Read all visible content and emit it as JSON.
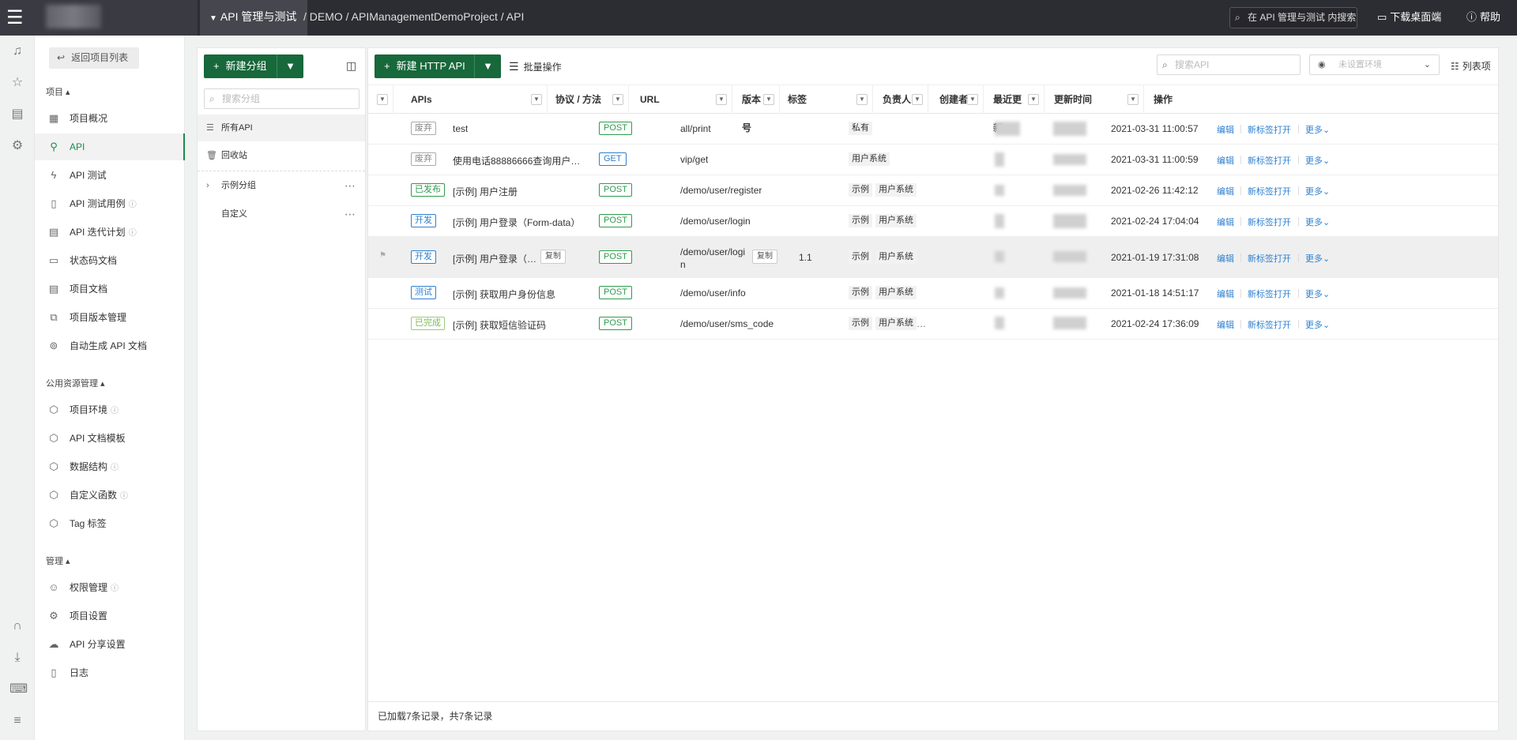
{
  "topbar": {
    "project_menu": "API 管理与测试",
    "breadcrumb": "/ DEMO / APIManagementDemoProject / API",
    "search_label": "在 API 管理与测试 内搜索",
    "download": "下载桌面端",
    "help": "帮助"
  },
  "sidebar": {
    "back": "返回项目列表",
    "section_project": "项目",
    "items_project": [
      "项目概况",
      "API",
      "API 测试",
      "API 测试用例",
      "API 迭代计划",
      "状态码文档",
      "项目文档",
      "项目版本管理",
      "自动生成 API 文档"
    ],
    "section_public": "公用资源管理",
    "items_public": [
      "项目环境",
      "API 文档模板",
      "数据结构",
      "自定义函数",
      "Tag 标签"
    ],
    "section_manage": "管理",
    "items_manage": [
      "权限管理",
      "项目设置",
      "API 分享设置",
      "日志"
    ]
  },
  "groups": {
    "new_group": "新建分组",
    "search_placeholder": "搜索分组",
    "all": "所有API",
    "recycle": "回收站",
    "example": "示例分组",
    "custom": "自定义"
  },
  "toolbar": {
    "new_http": "新建 HTTP API",
    "batch": "批量操作",
    "search_placeholder": "搜索API",
    "env_placeholder": "未设置环境",
    "list_items": "列表项"
  },
  "table": {
    "headers": [
      "APIs",
      "协议 / 方法",
      "URL",
      "版本号",
      "标签",
      "负责人",
      "创建者",
      "最近更新",
      "更新时间",
      "操作"
    ],
    "rows": [
      {
        "status": "废弃",
        "name": "test",
        "method": "POST",
        "url": "all/print",
        "version": "",
        "tags": [
          "私有"
        ],
        "time": "2021-03-31 11:00:57"
      },
      {
        "status": "废弃",
        "name": "使用电话88886666查询用户…",
        "method": "GET",
        "url": "vip/get",
        "version": "",
        "tags": [
          "用户系统"
        ],
        "time": "2021-03-31 11:00:59"
      },
      {
        "status": "已发布",
        "name": "[示例] 用户注册",
        "method": "POST",
        "url": "/demo/user/register",
        "version": "",
        "tags": [
          "示例",
          "用户系统"
        ],
        "time": "2021-02-26 11:42:12"
      },
      {
        "status": "开发",
        "name": "[示例] 用户登录（Form-data）",
        "method": "POST",
        "url": "/demo/user/login",
        "version": "",
        "tags": [
          "示例",
          "用户系统"
        ],
        "time": "2021-02-24 17:04:04"
      },
      {
        "status": "开发",
        "name": "[示例] 用户登录（…",
        "method": "POST",
        "url": "/demo/user/login",
        "version": "1.1",
        "tags": [
          "示例",
          "用户系统"
        ],
        "time": "2021-01-19 17:31:08"
      },
      {
        "status": "测试",
        "name": "[示例] 获取用户身份信息",
        "method": "POST",
        "url": "/demo/user/info",
        "version": "",
        "tags": [
          "示例",
          "用户系统"
        ],
        "time": "2021-01-18 14:51:17"
      },
      {
        "status": "已完成",
        "name": "[示例] 获取短信验证码",
        "method": "POST",
        "url": "/demo/user/sms_code",
        "version": "",
        "tags": [
          "示例",
          "用户系统"
        ],
        "time": "2021-02-24 17:36:09"
      }
    ],
    "ops": {
      "edit": "编辑",
      "open_tab": "新标签打开",
      "more": "更多"
    },
    "copy": "复制",
    "url_line1": "/demo/user/logi",
    "url_line2": "n"
  },
  "footer": "已加载7条记录，共7条记录",
  "colors": {
    "green": "#17683b",
    "method_green": "#2e9b4e",
    "link_blue": "#2f80d0"
  }
}
